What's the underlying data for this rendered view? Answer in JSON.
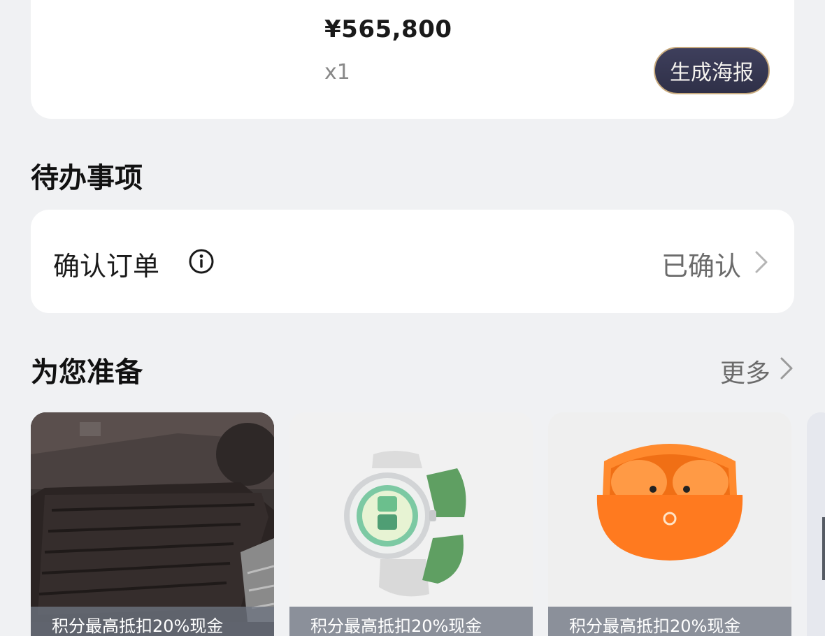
{
  "order": {
    "price": "¥565,800",
    "quantity": "x1",
    "poster_button_label": "生成海报"
  },
  "todo": {
    "section_title": "待办事项",
    "item_label": "确认订单",
    "item_status": "已确认"
  },
  "recommend": {
    "section_title": "为您准备",
    "more_label": "更多",
    "products": [
      {
        "name": "trunk-mat",
        "promo": "积分最高抵扣20%现金"
      },
      {
        "name": "smartwatch",
        "promo": "积分最高抵扣20%现金"
      },
      {
        "name": "earbuds",
        "promo": "积分最高抵扣20%现金"
      },
      {
        "name": "partial-product",
        "promo": ""
      }
    ]
  },
  "colors": {
    "background": "#f0f1f3",
    "card": "#ffffff",
    "poster_button_bg": "#33344d",
    "poster_button_border": "#c9ab7e",
    "muted_text": "#6b6b6b",
    "earbuds_orange": "#ff7a1f",
    "watch_strap_green": "#5f9f62"
  },
  "icons": {
    "info": "info-circle-icon",
    "chevron": "chevron-right-icon"
  }
}
